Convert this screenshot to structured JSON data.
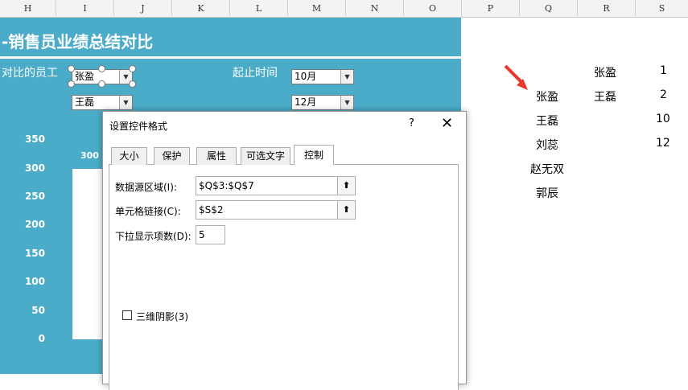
{
  "columns": [
    "H",
    "I",
    "J",
    "K",
    "L",
    "M",
    "N",
    "O",
    "P",
    "Q",
    "R",
    "S"
  ],
  "dashboard": {
    "title": "-销售员业绩总结对比",
    "employee_label": "对比的员工",
    "time_label": "起止时间",
    "employee_combo_1": "张盈",
    "employee_combo_2": "王磊",
    "time_combo_1": "10月",
    "time_combo_2": "12月",
    "y_ticks": [
      "350",
      "300",
      "250",
      "200",
      "150",
      "100",
      "50",
      "0"
    ],
    "bar_value_label": "300"
  },
  "sheet_cells": {
    "q": [
      "张盈",
      "王磊",
      "刘蕊",
      "赵无双",
      "郭辰"
    ],
    "r": [
      "张盈",
      "王磊"
    ],
    "s": [
      "1",
      "2",
      "10",
      "12"
    ]
  },
  "dialog": {
    "title": "设置控件格式",
    "help": "?",
    "close": "✕",
    "tabs": [
      "大小",
      "保护",
      "属性",
      "可选文字",
      "控制"
    ],
    "active_tab": "控制",
    "input_range_label": "数据源区域(I):",
    "input_range_value": "$Q$3:$Q$7",
    "cell_link_label": "单元格链接(C):",
    "cell_link_value": "$S$2",
    "dropdown_lines_label": "下拉显示项数(D):",
    "dropdown_lines_value": "5",
    "shading_label": "三维阴影(3)"
  },
  "colors": {
    "dashboard_bg": "#4aacc8",
    "arrow": "#e8392b"
  }
}
